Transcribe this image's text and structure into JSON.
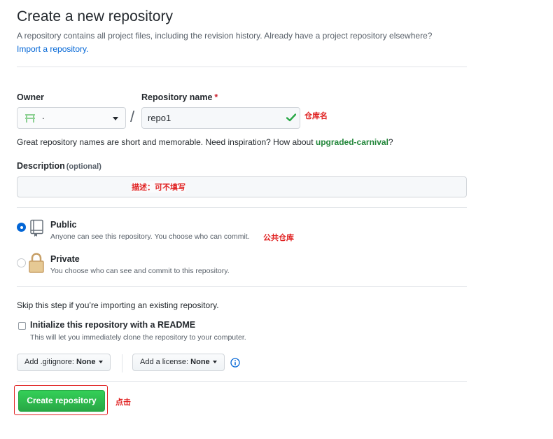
{
  "header": {
    "title": "Create a new repository",
    "subtitle": "A repository contains all project files, including the revision history. Already have a project repository elsewhere?",
    "import_link": "Import a repository."
  },
  "owner": {
    "label": "Owner",
    "value": "."
  },
  "repo_name": {
    "label": "Repository name",
    "required_mark": "*",
    "separator": "/",
    "value": "repo1"
  },
  "hint": {
    "text": "Great repository names are short and memorable. Need inspiration? How about ",
    "suggestion": "upgraded-carnival",
    "suffix": "?"
  },
  "description": {
    "label": "Description",
    "optional": "(optional)",
    "value": ""
  },
  "visibility": {
    "public": {
      "title": "Public",
      "desc": "Anyone can see this repository. You choose who can commit.",
      "selected": true
    },
    "private": {
      "title": "Private",
      "desc": "You choose who can see and commit to this repository.",
      "selected": false
    }
  },
  "init": {
    "skip_text": "Skip this step if you’re importing an existing repository.",
    "readme_title": "Initialize this repository with a README",
    "readme_desc": "This will let you immediately clone the repository to your computer.",
    "readme_checked": false
  },
  "gitignore": {
    "label": "Add .gitignore:",
    "value": "None"
  },
  "license": {
    "label": "Add a license:",
    "value": "None"
  },
  "create_button": "Create repository",
  "annotations": {
    "repo_name": "仓库名",
    "description": "描述：可不填写",
    "public": "公共仓库",
    "create": "点击"
  },
  "colors": {
    "link": "#0366d6",
    "primary_button": "#28a745",
    "suggestion": "#22863a",
    "annotation": "#e02020",
    "required": "#cb2431"
  },
  "icons": [
    "owner-avatar-icon",
    "check-icon",
    "repo-public-icon",
    "lock-icon",
    "info-icon"
  ]
}
